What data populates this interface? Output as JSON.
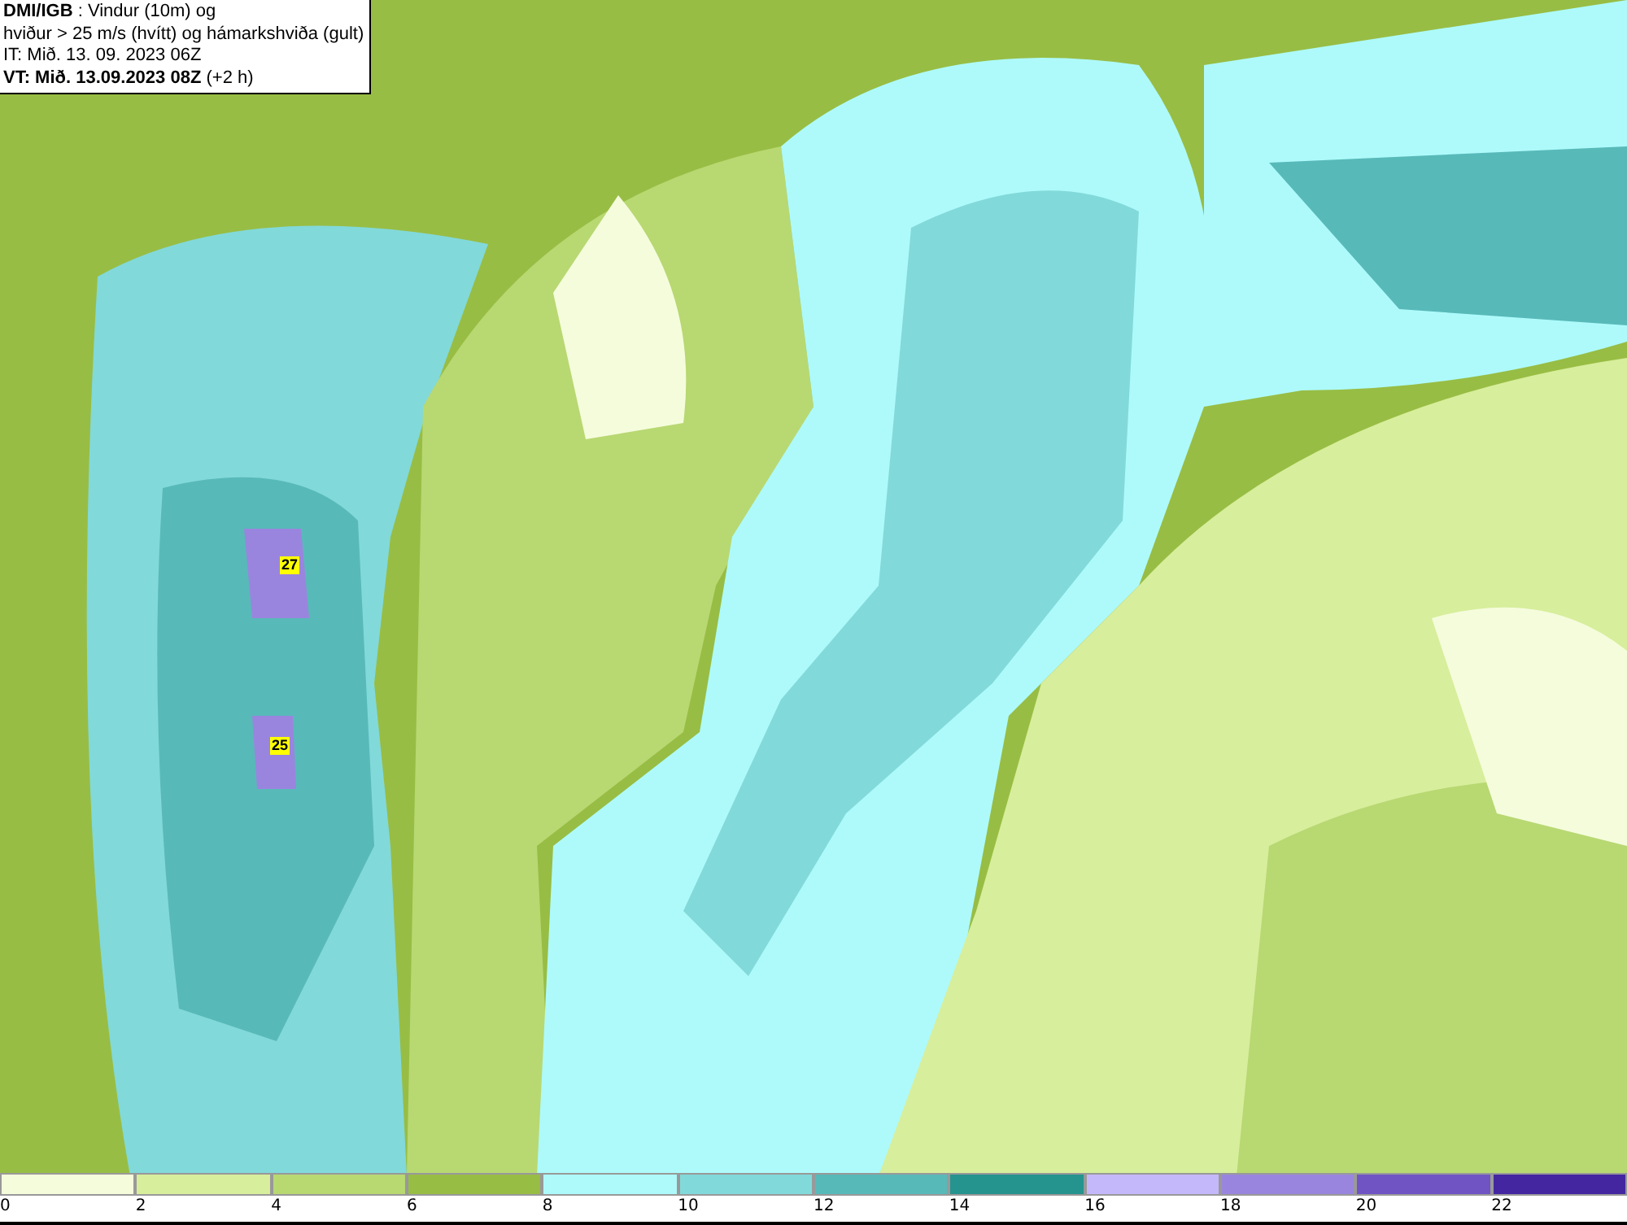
{
  "header": {
    "lines": [
      "**DMI/IGB** : Vindur (10m) og",
      "hviður > 25 m/s (hvítt) og hámarkshviða (gult)",
      "IT: Mið. 13. 09. 2023 06Z",
      "**VT: Mið. 13.09.2023 08Z** (+2 h)"
    ]
  },
  "map": {
    "markers": [
      {
        "label": "27"
      },
      {
        "label": "25"
      }
    ]
  },
  "legend": [
    {
      "label": "0",
      "color": "#f5fcdc"
    },
    {
      "label": "2",
      "color": "#d7ee9c"
    },
    {
      "label": "4",
      "color": "#b8d872"
    },
    {
      "label": "6",
      "color": "#98bd44"
    },
    {
      "label": "8",
      "color": "#aefafa"
    },
    {
      "label": "10",
      "color": "#82d9d9"
    },
    {
      "label": "12",
      "color": "#58b9b9"
    },
    {
      "label": "14",
      "color": "#25938e"
    },
    {
      "label": "16",
      "color": "#c5b8fa"
    },
    {
      "label": "18",
      "color": "#9a85de"
    },
    {
      "label": "20",
      "color": "#7054c4"
    },
    {
      "label": "22",
      "color": "#4427a0"
    }
  ]
}
